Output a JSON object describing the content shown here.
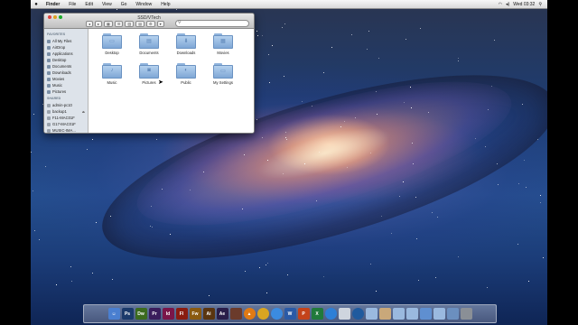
{
  "menubar": {
    "apple": "",
    "app": "Finder",
    "items": [
      "File",
      "Edit",
      "View",
      "Go",
      "Window",
      "Help"
    ],
    "clock": "Wed 03:32"
  },
  "finder": {
    "title": "SSD/VTech",
    "toolbar": [
      "◂",
      "▸",
      "▦",
      "☰",
      "▥",
      "▤",
      "⚙",
      "▾"
    ],
    "sidebar": {
      "favorites_header": "FAVORITES",
      "favorites": [
        "All My Files",
        "AirDrop",
        "Applications",
        "Desktop",
        "Documents",
        "Downloads",
        "Movies",
        "Music",
        "Pictures"
      ],
      "shared_header": "SHARED",
      "shared": [
        "admin-pc10",
        "backup1",
        "F11-MAC01F",
        "G17-MAC01F",
        "MUSIC-IMA..."
      ]
    },
    "folders": [
      "Desktop",
      "Documents",
      "Downloads",
      "Movies",
      "Music",
      "Pictures",
      "Public",
      "My Settings"
    ]
  },
  "dock": {
    "apps": [
      {
        "name": "finder",
        "label": "☺",
        "color": "#4a7fd0"
      },
      {
        "name": "photoshop",
        "label": "Ps",
        "color": "#1b3a6b"
      },
      {
        "name": "dreamweaver",
        "label": "Dw",
        "color": "#3c6b1f"
      },
      {
        "name": "premiere",
        "label": "Pr",
        "color": "#3a1d5c"
      },
      {
        "name": "indesign",
        "label": "Id",
        "color": "#7a1549"
      },
      {
        "name": "flash",
        "label": "Fl",
        "color": "#8a1c10"
      },
      {
        "name": "fireworks",
        "label": "Fw",
        "color": "#8a5a10"
      },
      {
        "name": "illustrator",
        "label": "Ai",
        "color": "#5a3510"
      },
      {
        "name": "after-effects",
        "label": "Ae",
        "color": "#2a1e4a"
      },
      {
        "name": "dictionary",
        "label": "",
        "color": "#6b3b2b"
      },
      {
        "name": "vlc",
        "label": "▲",
        "color": "#e07a14"
      },
      {
        "name": "chrome",
        "label": "",
        "color": "#d9a521"
      },
      {
        "name": "safari",
        "label": "",
        "color": "#3b8be0"
      },
      {
        "name": "word",
        "label": "W",
        "color": "#2a5aa6"
      },
      {
        "name": "powerpoint",
        "label": "P",
        "color": "#c4431a"
      },
      {
        "name": "excel",
        "label": "X",
        "color": "#207a3b"
      },
      {
        "name": "app-store",
        "label": "",
        "color": "#2e7fd6"
      },
      {
        "name": "preview",
        "label": "",
        "color": "#cfd5de"
      },
      {
        "name": "quicktime",
        "label": "",
        "color": "#1f5a9e"
      },
      {
        "name": "applications-folder",
        "label": "",
        "color": "#9ab9df"
      },
      {
        "name": "documents-stack",
        "label": "",
        "color": "#c9a87a"
      },
      {
        "name": "downloads-folder",
        "label": "",
        "color": "#9ab9df"
      },
      {
        "name": "pictures-folder",
        "label": "",
        "color": "#9ab9df"
      },
      {
        "name": "downloads-stack",
        "label": "",
        "color": "#5f8fd0"
      },
      {
        "name": "folder-stack",
        "label": "",
        "color": "#9ab9df"
      },
      {
        "name": "finder-stack",
        "label": "",
        "color": "#6b8fbf"
      },
      {
        "name": "trash",
        "label": "",
        "color": "#8a8f96"
      }
    ]
  }
}
